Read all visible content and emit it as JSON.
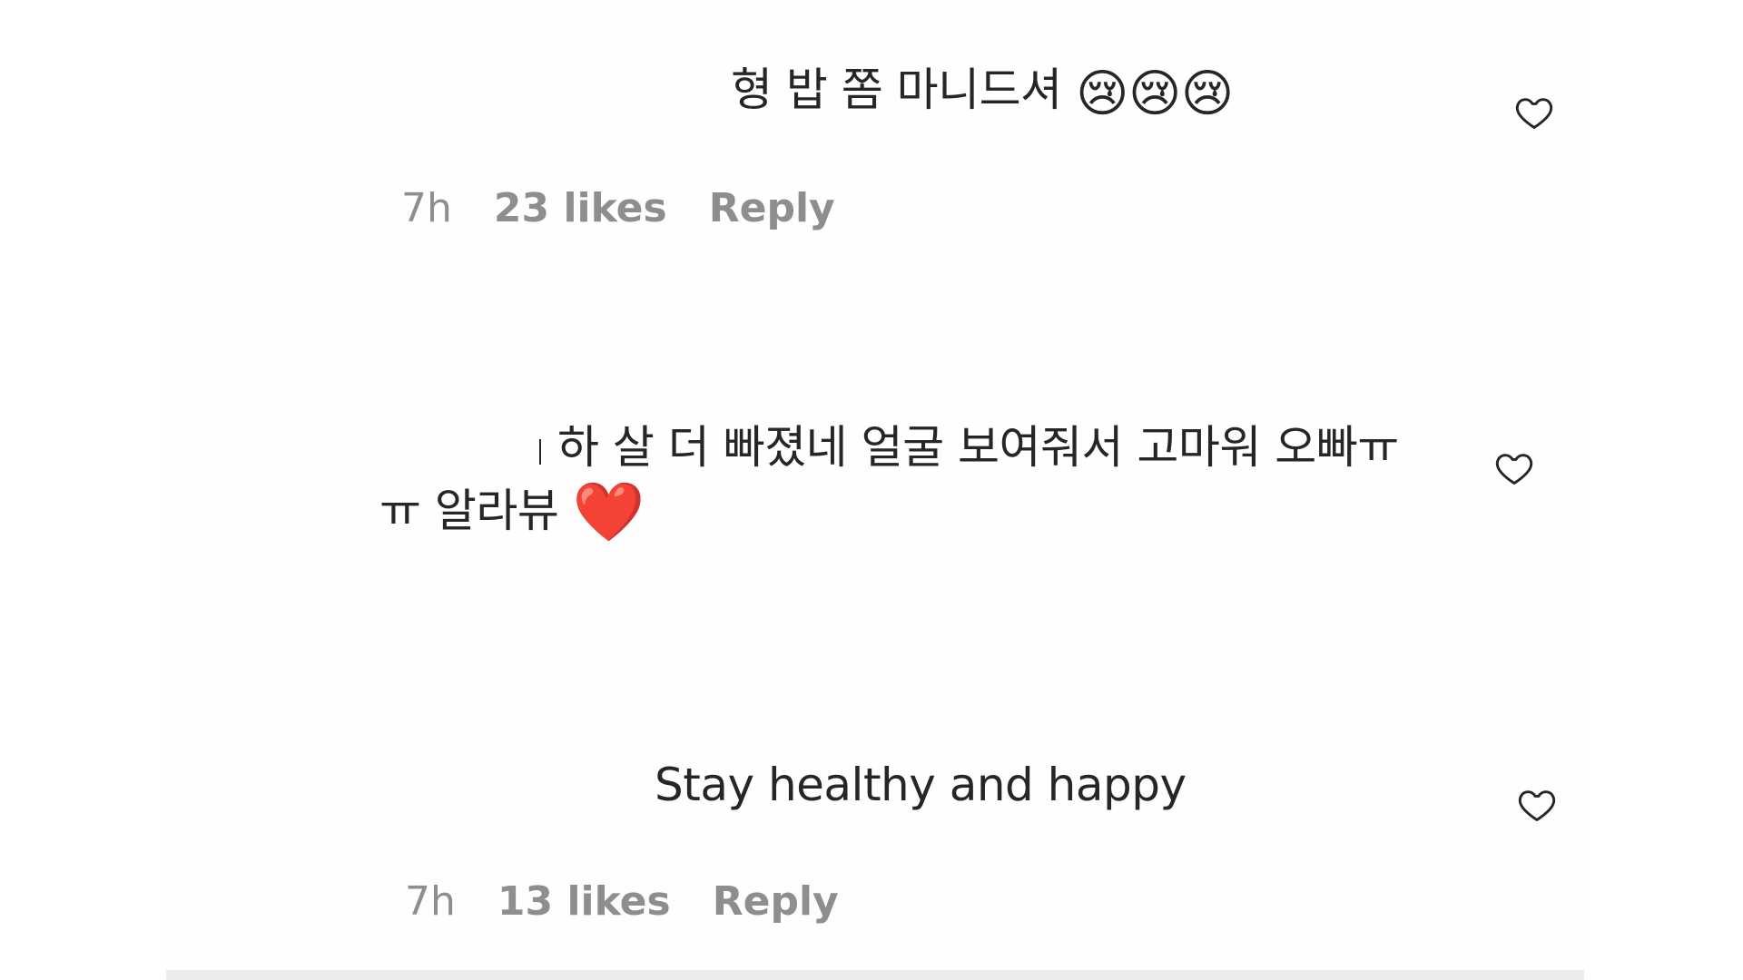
{
  "comments": [
    {
      "text": "형 밥 쫌 마니드셔",
      "emoji": "😢😢😢",
      "time": "7h",
      "likes": "23 likes",
      "reply": "Reply"
    },
    {
      "line1": "하 살 더 빠졌네 얼굴 보여줘서 고마워 오빠ㅠ",
      "line2": "ㅠ 알라뷰",
      "emoji": "❤️"
    },
    {
      "text": "Stay healthy and happy",
      "time": "7h",
      "likes": "13 likes",
      "reply": "Reply"
    }
  ],
  "icons": {
    "like": "heart-outline-icon"
  },
  "colors": {
    "text": "#262626",
    "meta": "#8e8e8e",
    "background": "#ffffff"
  }
}
